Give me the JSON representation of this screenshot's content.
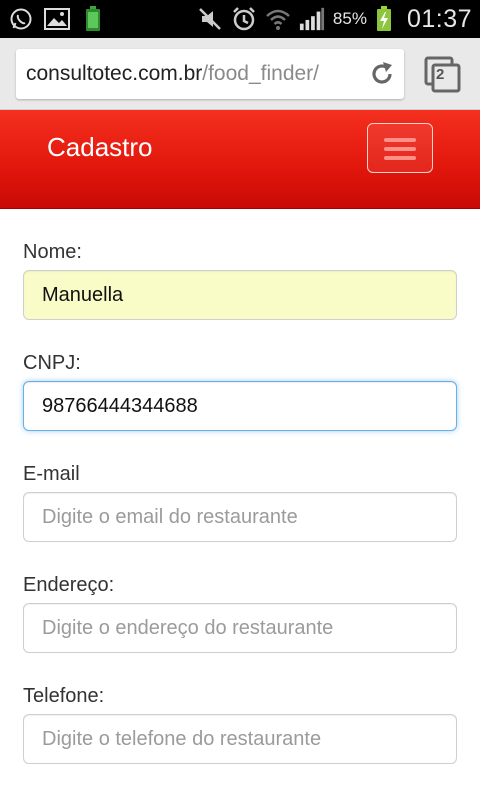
{
  "status_bar": {
    "battery_percent": "85%",
    "time": "01:37",
    "icons": [
      "whatsapp-icon",
      "gallery-icon",
      "battery-app-icon",
      "mute-icon",
      "alarm-icon",
      "wifi-icon",
      "signal-icon",
      "battery-charging-icon"
    ]
  },
  "browser": {
    "url_host": "consultotec.com.br",
    "url_path": "/food_finder/",
    "tab_count": "2"
  },
  "navbar": {
    "brand": "Cadastro",
    "accent": "#e1160c"
  },
  "form": {
    "nome": {
      "label": "Nome:",
      "value": "Manuella"
    },
    "cnpj": {
      "label": "CNPJ:",
      "value": "98766444344688"
    },
    "email": {
      "label": "E-mail",
      "placeholder": "Digite o email do restaurante"
    },
    "endereco": {
      "label": "Endereço:",
      "placeholder": "Digite o endereço do restaurante"
    },
    "telefone": {
      "label": "Telefone:",
      "placeholder": "Digite o telefone do restaurante"
    }
  }
}
